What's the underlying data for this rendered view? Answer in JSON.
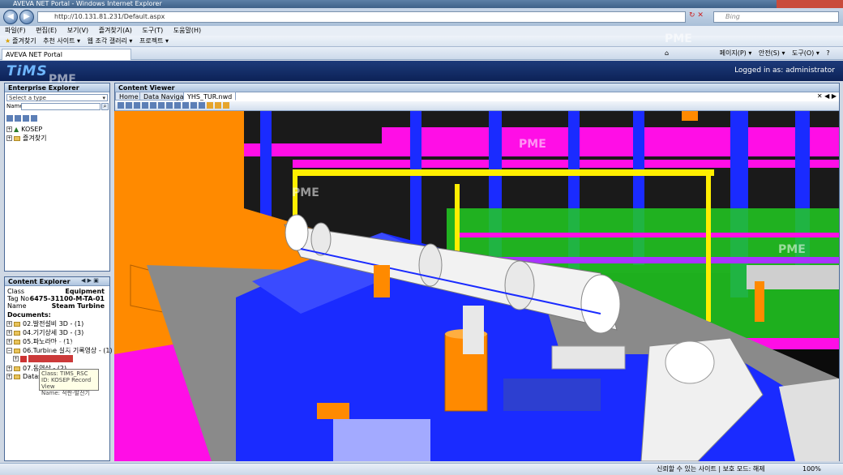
{
  "window": {
    "title": "AVEVA NET Portal - Windows Internet Explorer"
  },
  "browser": {
    "address": "http://10.131.81.231/Default.aspx",
    "search_placeholder": "Bing",
    "menu": [
      "파일(F)",
      "편집(E)",
      "보기(V)",
      "즐겨찾기(A)",
      "도구(T)",
      "도움말(H)"
    ],
    "favorites": [
      "즐겨찾기",
      "추천 사이트 ▾",
      "웹 조각 갤러리 ▾",
      "프로젝트 ▾"
    ],
    "tab_label": "AVEVA NET Portal",
    "commands": [
      "페이지(P) ▾",
      "안전(S) ▾",
      "도구(O) ▾",
      "?"
    ],
    "status": "신뢰할 수 있는 사이트 | 보호 모드: 해제",
    "zoom": "100%"
  },
  "header": {
    "logo": "TiMS",
    "logged_in": "Logged in as: administrator"
  },
  "enterprise_explorer": {
    "title": "Enterprise Explorer",
    "type_placeholder": "Select a type",
    "name_label": "Name",
    "tree": [
      "KOSEP",
      "즐겨찾기"
    ]
  },
  "content_explorer": {
    "title": "Content Explorer",
    "class_label": "Class",
    "class_value": "Equipment",
    "tag_label": "Tag No",
    "tag_value": "6475-31100-M-TA-01",
    "name_label": "Name",
    "name_value": "Steam Turbine",
    "documents_label": "Documents:",
    "documents": [
      "02.발전설비 3D - (1)",
      "04.기기상세 3D - (3)",
      "05.파노라마 - (1)",
      "06.Turbine 설치 기록영상 - (1)",
      "YHS_TUR.nwd",
      "07.동영상 - (2)",
      "Datasets"
    ],
    "tooltip": [
      "Class: TIMS_RSC",
      "ID: KOSEP Record View",
      "Name: 적판-발전기"
    ]
  },
  "content_viewer": {
    "title": "Content Viewer",
    "tabs": [
      "Home",
      "Data Navigator",
      "YHS_TUR.nwd"
    ]
  },
  "watermark": "PME"
}
